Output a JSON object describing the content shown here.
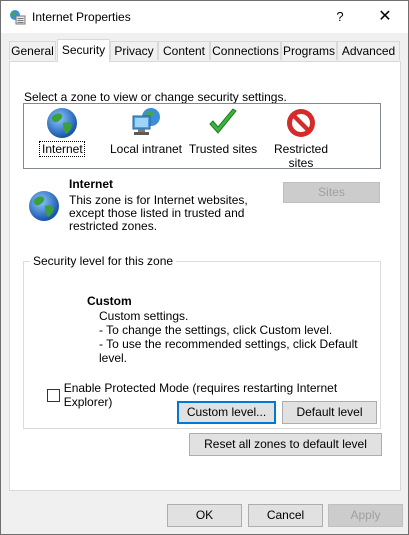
{
  "window": {
    "title": "Internet Properties",
    "help_button": "?",
    "close_button": "✕"
  },
  "tabs": [
    {
      "label": "General",
      "active": false
    },
    {
      "label": "Security",
      "active": true
    },
    {
      "label": "Privacy",
      "active": false
    },
    {
      "label": "Content",
      "active": false
    },
    {
      "label": "Connections",
      "active": false
    },
    {
      "label": "Programs",
      "active": false
    },
    {
      "label": "Advanced",
      "active": false
    }
  ],
  "security": {
    "zone_prompt": "Select a zone to view or change security settings.",
    "zones": [
      {
        "label": "Internet",
        "icon": "globe-icon",
        "selected": true
      },
      {
        "label": "Local intranet",
        "icon": "intranet-icon",
        "selected": false
      },
      {
        "label": "Trusted sites",
        "icon": "checkmark-icon",
        "selected": false
      },
      {
        "label_line1": "Restricted",
        "label_line2": "sites",
        "icon": "restricted-icon",
        "selected": false
      }
    ],
    "selected_zone": {
      "title": "Internet",
      "description": "This zone is for Internet websites, except those listed in trusted and restricted zones."
    },
    "sites_button": "Sites",
    "level_group": {
      "legend": "Security level for this zone",
      "level_title": "Custom",
      "lines": [
        "Custom settings.",
        "- To change the settings, click Custom level.",
        "- To use the recommended settings, click Default level."
      ],
      "protected_mode_label": "Enable Protected Mode (requires restarting Internet Explorer)",
      "protected_mode_checked": false,
      "custom_level_button": "Custom level...",
      "default_level_button": "Default level"
    },
    "reset_button": "Reset all zones to default level"
  },
  "footer": {
    "ok": "OK",
    "cancel": "Cancel",
    "apply": "Apply"
  },
  "colors": {
    "accent": "#0078d7",
    "globe_blue": "#1e6fc9",
    "globe_green": "#3aa03c",
    "check_green": "#3cb33c",
    "restricted_red": "#d62b2b"
  }
}
